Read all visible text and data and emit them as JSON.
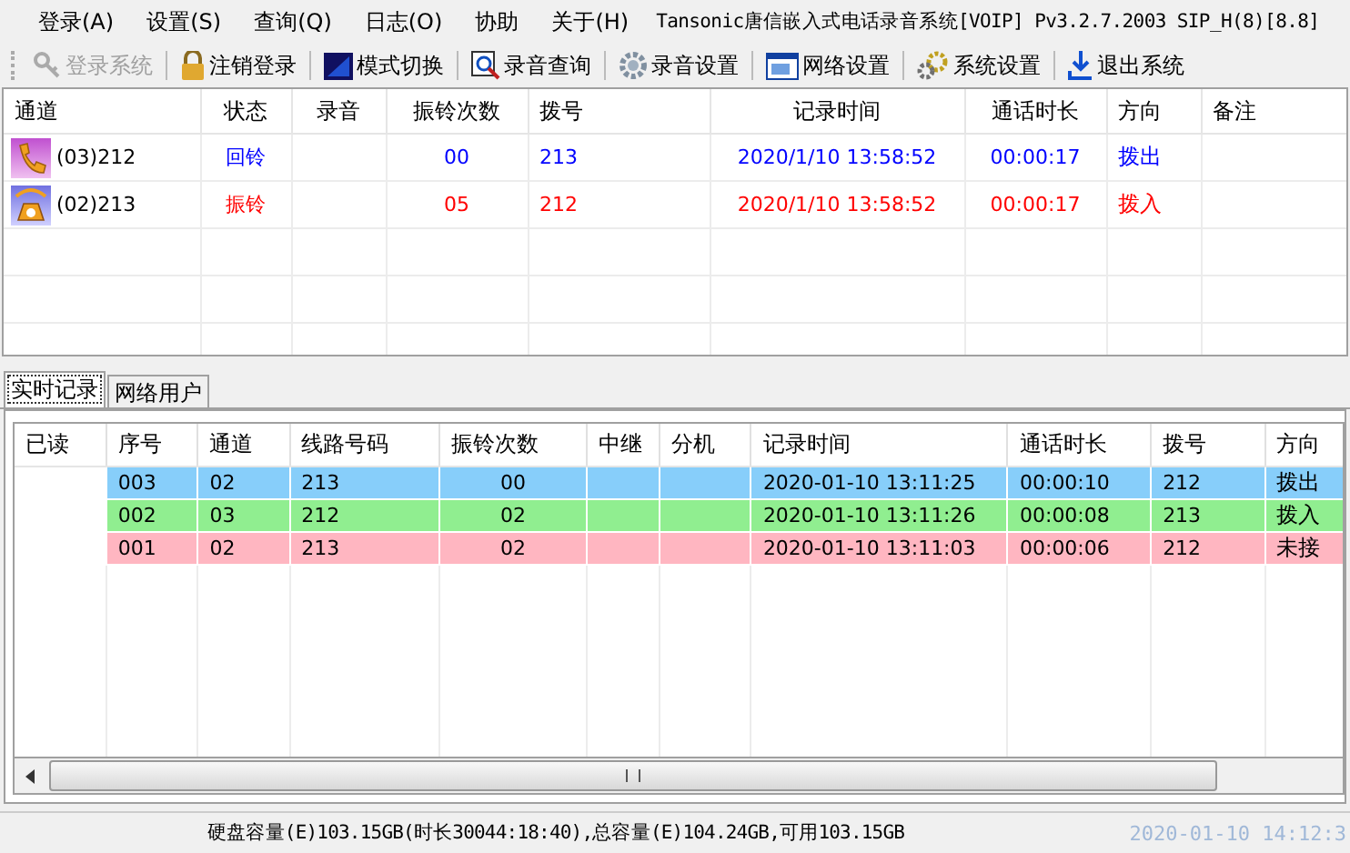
{
  "menu": [
    {
      "label": "登录(A)"
    },
    {
      "label": "设置(S)"
    },
    {
      "label": "查询(Q)"
    },
    {
      "label": "日志(O)"
    },
    {
      "label": "协助"
    },
    {
      "label": "关于(H)"
    }
  ],
  "window": {
    "title": "Tansonic唐信嵌入式电话录音系统[VOIP] Pv3.2.7.2003 SIP_H(8)[8.8]"
  },
  "toolbar": [
    {
      "label": "登录系统",
      "kind": "key",
      "disabled": true
    },
    {
      "label": "注销登录",
      "kind": "lock",
      "disabled": false
    },
    {
      "label": "模式切换",
      "kind": "screen",
      "disabled": false
    },
    {
      "label": "录音查询",
      "kind": "search",
      "disabled": false
    },
    {
      "label": "录音设置",
      "kind": "gear",
      "disabled": false
    },
    {
      "label": "网络设置",
      "kind": "window",
      "disabled": false
    },
    {
      "label": "系统设置",
      "kind": "gears",
      "disabled": false
    },
    {
      "label": "退出系统",
      "kind": "exit",
      "disabled": false
    }
  ],
  "channels": {
    "columns": [
      "通道",
      "状态",
      "录音",
      "振铃次数",
      "拨号",
      "记录时间",
      "通话时长",
      "方向",
      "备注"
    ],
    "rows": [
      {
        "kind": "handset",
        "color": "#0000ff",
        "channel": "(03)212",
        "status": "回铃",
        "rings": "00",
        "dial": "213",
        "time": "2020/1/10 13:58:52",
        "duration": "00:00:17",
        "direction": "拨出"
      },
      {
        "kind": "ringing",
        "color": "#ff0000",
        "channel": "(02)213",
        "status": "振铃",
        "rings": "05",
        "dial": "212",
        "time": "2020/1/10 13:58:52",
        "duration": "00:00:17",
        "direction": "拨入"
      }
    ]
  },
  "tabs": [
    {
      "label": "实时记录",
      "selected": true
    },
    {
      "label": "网络用户",
      "selected": false
    }
  ],
  "records": {
    "columns": [
      "已读",
      "序号",
      "通道",
      "线路号码",
      "振铃次数",
      "中继",
      "分机",
      "记录时间",
      "通话时长",
      "拨号",
      "方向"
    ],
    "rows": [
      {
        "color": "#87cefa",
        "cells": [
          "",
          "003",
          "02",
          "213",
          "00",
          "",
          "",
          "2020-01-10 13:11:25",
          "00:00:10",
          "212",
          "拨出"
        ]
      },
      {
        "color": "#90ee90",
        "cells": [
          "",
          "002",
          "03",
          "212",
          "02",
          "",
          "",
          "2020-01-10 13:11:26",
          "00:00:08",
          "213",
          "拨入"
        ]
      },
      {
        "color": "#ffb6c1",
        "cells": [
          "",
          "001",
          "02",
          "213",
          "02",
          "",
          "",
          "2020-01-10 13:11:03",
          "00:00:06",
          "212",
          "未接"
        ]
      }
    ]
  },
  "status_bar": {
    "disk": "硬盘容量(E)103.15GB(时长30044:18:40),总容量(E)104.24GB,可用103.15GB",
    "clock": "2020-01-10 14:12:3"
  }
}
